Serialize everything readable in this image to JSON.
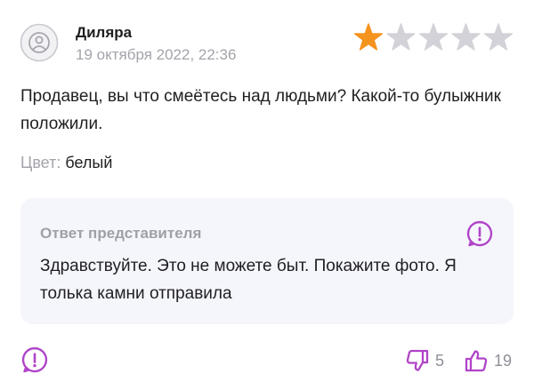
{
  "review": {
    "author": "Диляра",
    "date": "19 октября 2022, 22:36",
    "rating": 1,
    "rating_max": 5,
    "text": "Продавец, вы что смеётесь над людьми? Какой-то булыжник положили.",
    "attribute": {
      "label": "Цвет:",
      "value": "белый"
    }
  },
  "reply": {
    "title": "Ответ представителя",
    "text": "Здравствуйте. Это не можете быт. Покажите фото. Я толька камни отправила"
  },
  "footer": {
    "dislikes": "5",
    "likes": "19"
  },
  "colors": {
    "accent": "#b044c8",
    "star_filled": "#f5931f",
    "star_empty": "#d2d2d8",
    "muted_text": "#a3a3ab",
    "card_bg": "#f5f6fb"
  },
  "icons": {
    "avatar": "user-avatar-icon",
    "star": "star-icon",
    "report": "report-exclamation-icon",
    "dislike": "thumbs-down-icon",
    "like": "thumbs-up-icon"
  }
}
